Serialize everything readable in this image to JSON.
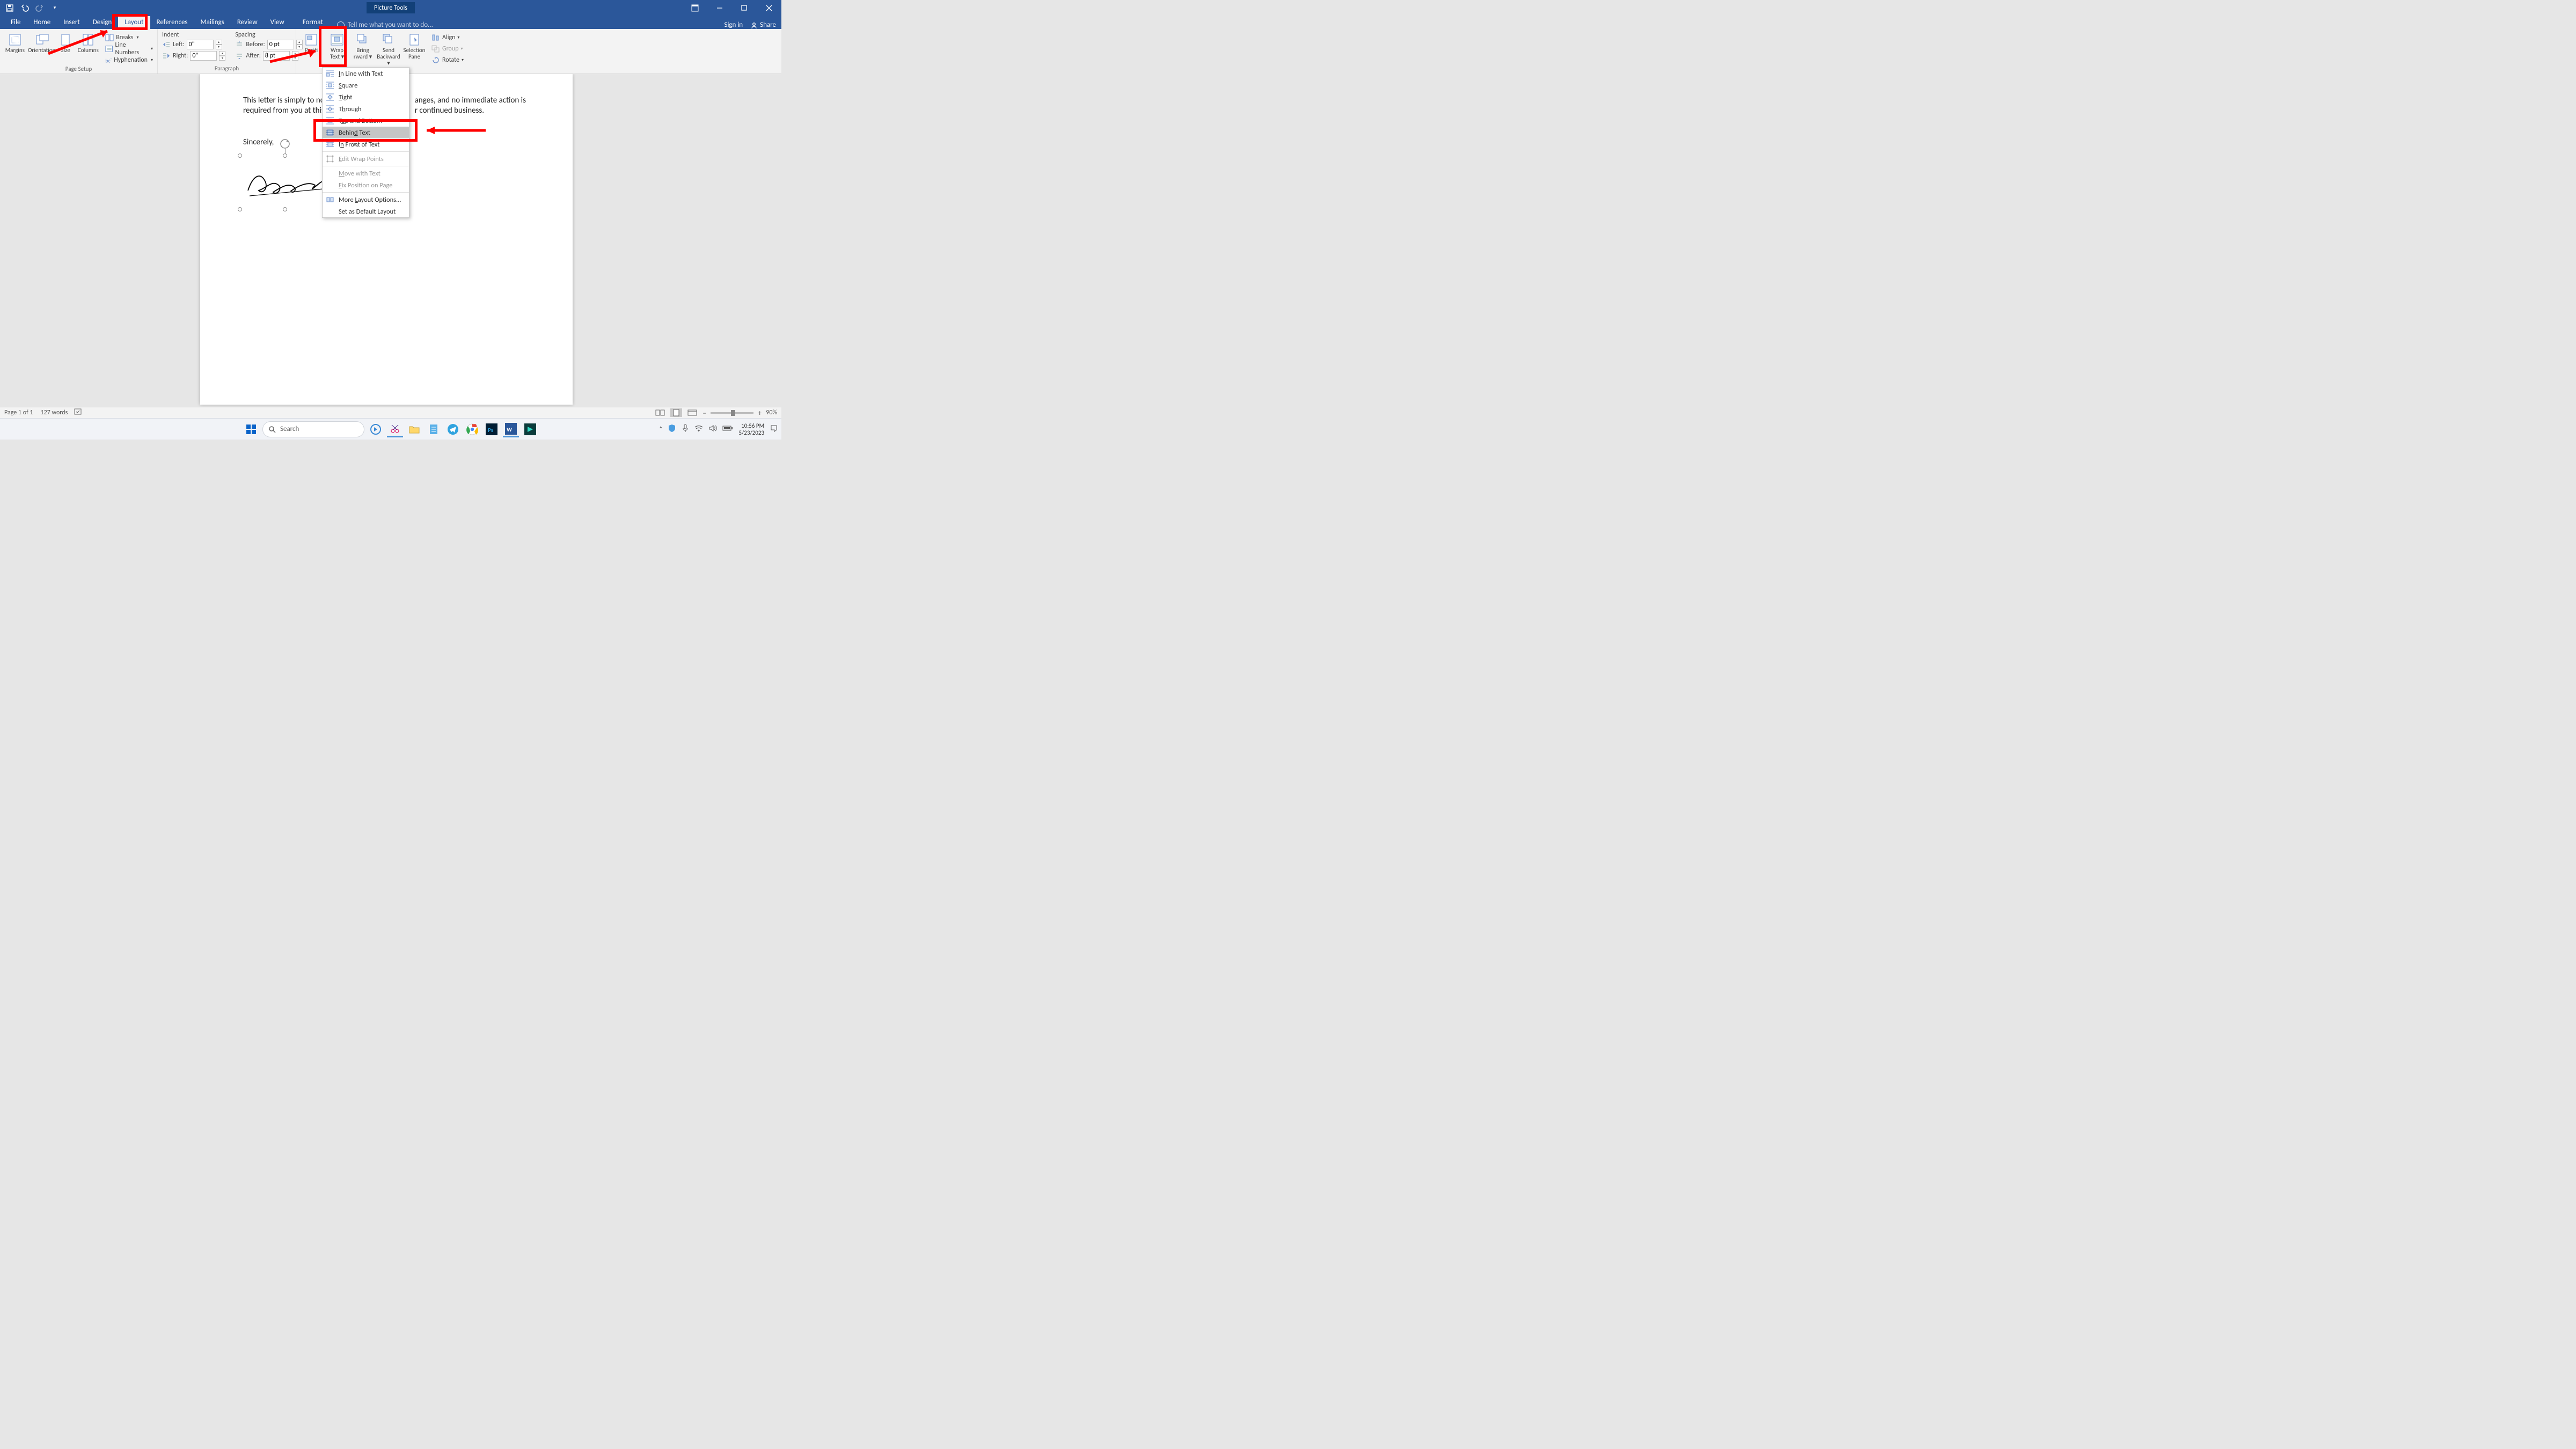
{
  "titlebar": {
    "context_tab": "Picture Tools"
  },
  "window": {
    "sign_in": "Sign in",
    "share": "Share"
  },
  "tabs": [
    "File",
    "Home",
    "Insert",
    "Design",
    "Layout",
    "References",
    "Mailings",
    "Review",
    "View",
    "Format"
  ],
  "active_tab_index": 4,
  "tellme": "Tell me what you want to do...",
  "ribbon": {
    "page_setup": {
      "label": "Page Setup",
      "margins": "Margins",
      "orientation": "Orientation",
      "size": "Size",
      "columns": "Columns",
      "breaks": "Breaks",
      "line_numbers": "Line Numbers",
      "hyphenation": "Hyphenation"
    },
    "indent": {
      "header": "Indent",
      "left_label": "Left:",
      "left_val": "0\"",
      "right_label": "Right:",
      "right_val": "0\""
    },
    "spacing": {
      "header": "Spacing",
      "before_label": "Before:",
      "before_val": "0 pt",
      "after_label": "After:",
      "after_val": "8 pt"
    },
    "paragraph_label": "Paragraph",
    "arrange": {
      "position": "Position",
      "wrap": "Wrap\nText",
      "bring": "Bring\nForward",
      "send": "Send\nBackward",
      "selection": "Selection\nPane",
      "align": "Align",
      "group": "Group",
      "rotate": "Rotate"
    }
  },
  "dropdown": {
    "items": [
      {
        "key": "inline",
        "label": "In Line with Text"
      },
      {
        "key": "square",
        "label": "Square"
      },
      {
        "key": "tight",
        "label": "Tight"
      },
      {
        "key": "through",
        "label": "Through"
      },
      {
        "key": "topbottom",
        "label": "Top and Bottom"
      },
      {
        "key": "behind",
        "label": "Behind Text"
      },
      {
        "key": "infront",
        "label": "In Front of Text"
      }
    ],
    "edit_points": "Edit Wrap Points",
    "move_with": "Move with Text",
    "fix_pos": "Fix Position on Page",
    "more": "More Layout Options...",
    "set_default": "Set as Default Layout"
  },
  "document": {
    "para1_a": "This letter is simply to no",
    "para1_b": "anges, and no immediate action is",
    "para2_a": "required from you at this",
    "para2_b": "r continued business.",
    "sincerely": "Sincerely,"
  },
  "status": {
    "page": "Page 1 of 1",
    "words": "127 words",
    "zoom": "90%",
    "zoom_plus": "+",
    "zoom_minus": "–"
  },
  "taskbar": {
    "search": "Search",
    "time": "10:56 PM",
    "date": "5/23/2023"
  }
}
